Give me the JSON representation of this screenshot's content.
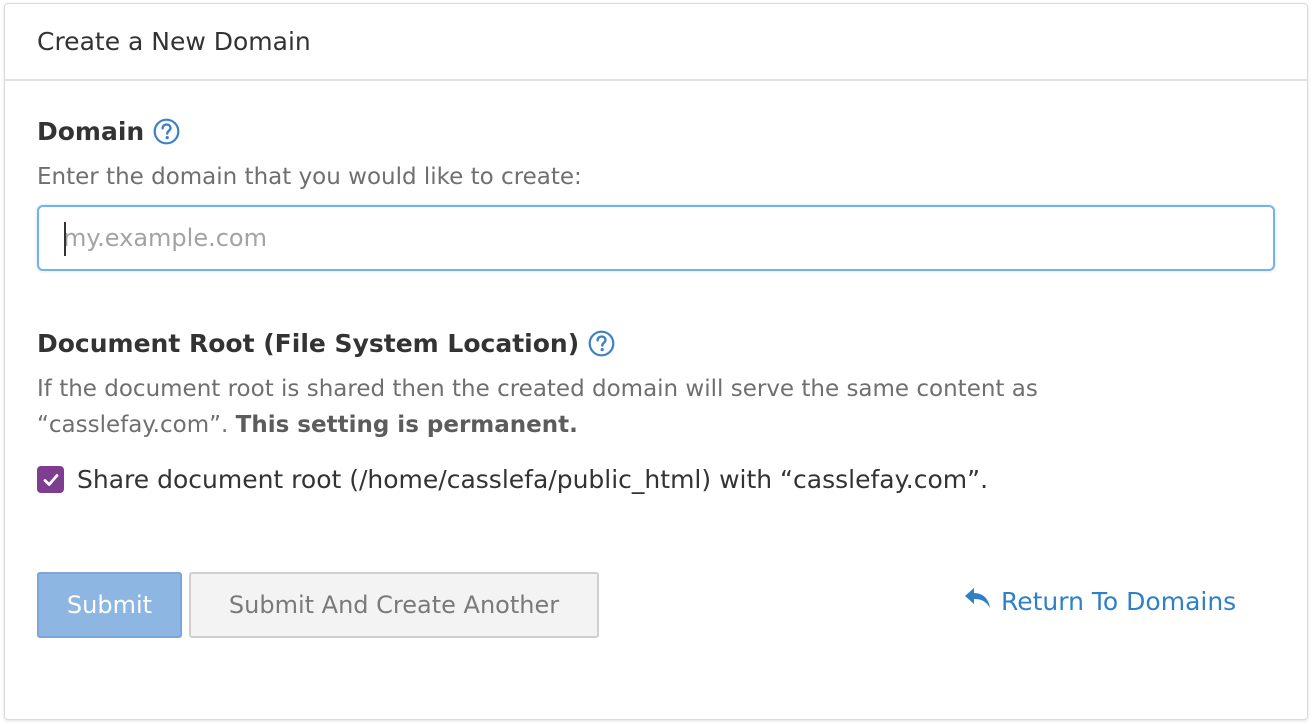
{
  "panel": {
    "title": "Create a New Domain"
  },
  "domain_field": {
    "label": "Domain",
    "help_icon": "question-circle-icon",
    "description": "Enter the domain that you would like to create:",
    "placeholder": "my.example.com",
    "value": ""
  },
  "docroot_field": {
    "label": "Document Root (File System Location)",
    "help_icon": "question-circle-icon",
    "description_line1": "If the document root is shared then the created domain will serve the same content as",
    "description_line2_prefix": "“casslefay.com”. ",
    "description_line2_bold": "This setting is permanent.",
    "share_checked": true,
    "share_label": "Share document root (/home/casslefa/public_html) with “casslefay.com”."
  },
  "actions": {
    "submit_label": "Submit",
    "submit_another_label": "Submit And Create Another",
    "return_label": "Return To Domains",
    "return_icon": "reply-arrow-icon"
  },
  "colors": {
    "accent_blue": "#2f80c6",
    "checkbox_purple": "#7e3d8f",
    "submit_bg": "#8db6e3",
    "input_focus_border": "#74b3e8"
  }
}
